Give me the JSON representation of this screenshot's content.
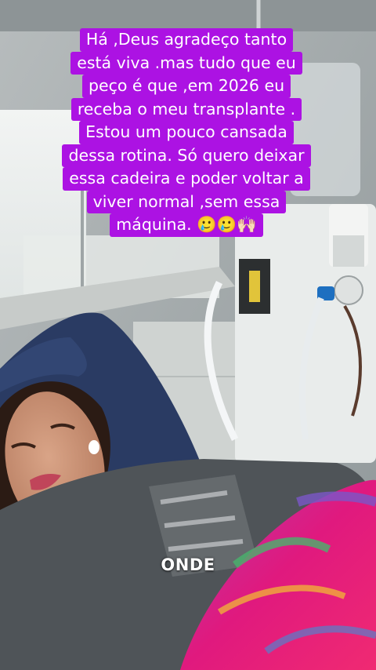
{
  "caption": {
    "lines": [
      "Há ,Deus agradeço tanto",
      "está viva .mas tudo que eu",
      "peço é que ,em 2026 eu",
      "receba o meu transplante .",
      "Estou um pouco cansada",
      "dessa rotina. Só quero deixar",
      "essa cadeira e poder voltar a",
      "viver normal ,sem essa",
      "máquina. 🥲🥲🙌🏻"
    ]
  },
  "subtitle": "ONDE",
  "colors": {
    "caption_bg": "#ac12e3",
    "caption_text": "#ffffff",
    "chair": "#2a3b63",
    "sweatshirt": "#4f5458",
    "blanket": "#e0197e"
  }
}
